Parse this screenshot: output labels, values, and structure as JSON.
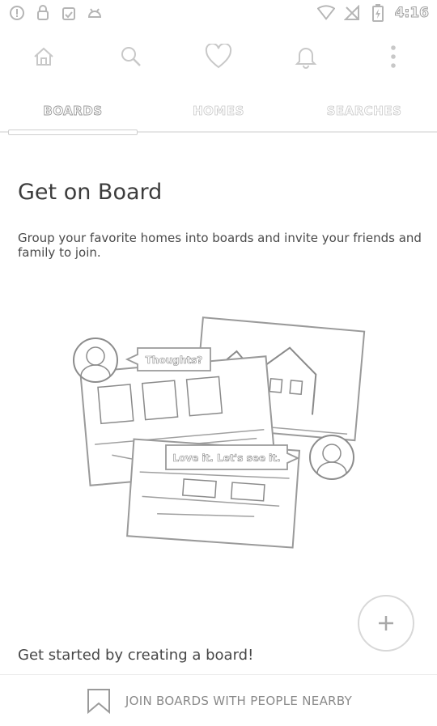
{
  "status_bar": {
    "time": "4:16",
    "left_icons": [
      "alert-circle-icon",
      "lock-icon",
      "clipboard-icon",
      "android-icon"
    ],
    "right_icons": [
      "wifi-icon",
      "no-signal-icon",
      "battery-charging-icon"
    ]
  },
  "top_nav": {
    "icons": [
      "home-icon",
      "search-icon",
      "heart-icon",
      "bell-icon",
      "more-vertical-icon"
    ]
  },
  "tabs": [
    {
      "label": "BOARDS",
      "active": true
    },
    {
      "label": "HOMES",
      "active": false
    },
    {
      "label": "SEARCHES",
      "active": false
    }
  ],
  "main": {
    "title": "Get on Board",
    "description": "Group your favorite homes into boards and invite your friends and family to join.",
    "illustration": {
      "bubble_top": "Thoughts?",
      "bubble_bottom": "Love it. Let's see it."
    },
    "cta_text": "Get started by creating a board!"
  },
  "fab": {
    "icon": "plus-icon"
  },
  "bottom_bar": {
    "label": "JOIN BOARDS WITH PEOPLE NEARBY",
    "icon": "bookmark-ribbon-icon"
  },
  "colors": {
    "background": "#ffffff",
    "text": "#3c3c3c",
    "muted": "#8a8a8a",
    "divider": "#e6e6e6"
  }
}
